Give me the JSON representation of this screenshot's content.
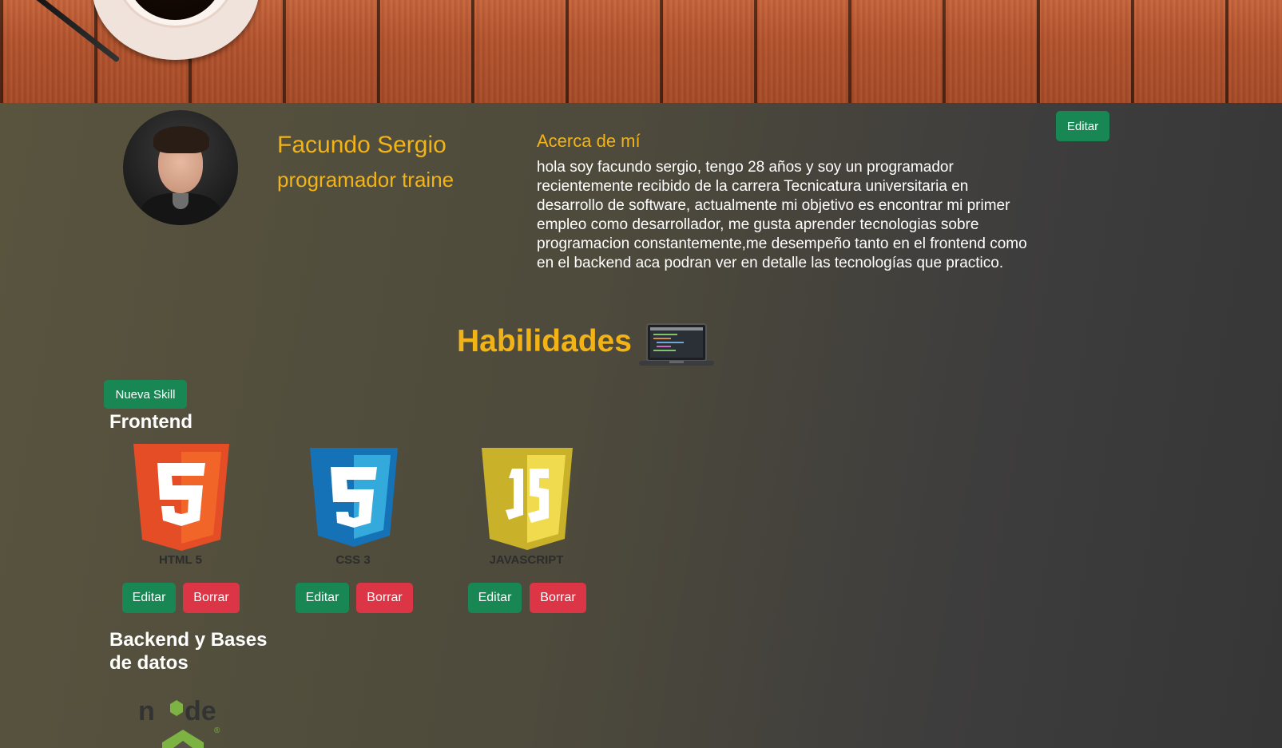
{
  "profile": {
    "name": "Facundo Sergio",
    "role": "programador traine",
    "edit_label": "Editar"
  },
  "about": {
    "title": "Acerca de mí",
    "text": "hola soy facundo sergio, tengo 28 años y soy un programador recientemente recibido de la carrera Tecnicatura universitaria en desarrollo de software, actualmente mi objetivo es encontrar mi primer empleo como desarrollador, me gusta aprender tecnologias sobre programacion constantemente,me desempeño tanto en el frontend como en el backend aca podran ver en detalle las tecnologías que practico."
  },
  "skills": {
    "title": "Habilidades",
    "new_skill_label": "Nueva Skill",
    "categories": {
      "frontend": "Frontend",
      "backend": "Backend y Bases de datos"
    },
    "frontend_items": [
      {
        "name": "HTML 5",
        "icon": "html5-icon",
        "edit": "Editar",
        "delete": "Borrar"
      },
      {
        "name": "CSS 3",
        "icon": "css3-icon",
        "edit": "Editar",
        "delete": "Borrar"
      },
      {
        "name": "JAVASCRIPT",
        "icon": "javascript-icon",
        "edit": "Editar",
        "delete": "Borrar"
      }
    ],
    "backend_items": [
      {
        "icon": "nodejs-icon"
      }
    ]
  },
  "colors": {
    "accent": "#f2b316",
    "green": "#198754",
    "red": "#dc3545"
  }
}
